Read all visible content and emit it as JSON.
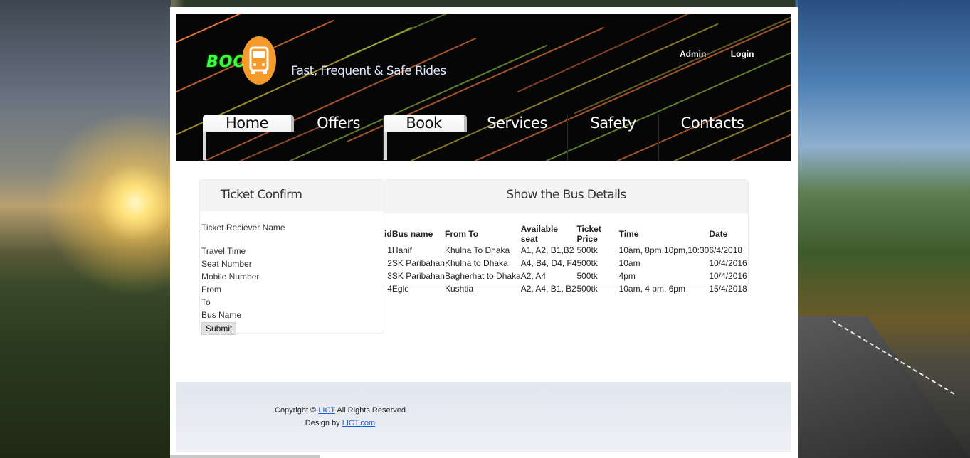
{
  "header": {
    "logo_text": "BOOK",
    "tagline": "Fast, Frequent & Safe Rides",
    "links": [
      {
        "label": "Admin"
      },
      {
        "label": "Login"
      }
    ]
  },
  "nav": {
    "items": [
      {
        "label": "Home",
        "active": true
      },
      {
        "label": "Offers",
        "active": false
      },
      {
        "label": "Book",
        "active": true
      },
      {
        "label": "Services",
        "active": false
      },
      {
        "label": "Safety",
        "active": false
      },
      {
        "label": "Contacts",
        "active": false
      }
    ]
  },
  "ticket_panel": {
    "title": "Ticket Confirm",
    "fields": [
      "Ticket Reciever Name",
      "Travel Time",
      "Seat Number",
      "Mobile Number",
      "From",
      "To",
      "Bus Name"
    ],
    "submit_label": "Submit"
  },
  "bus_panel": {
    "title": "Show the Bus Details",
    "columns": [
      "id",
      "Bus name",
      "From To",
      "Available seat",
      "Ticket Price",
      "Time",
      "Date"
    ],
    "rows": [
      [
        "1",
        "Hanif",
        "Khulna To Dhaka",
        "A1, A2, B1,B2",
        "500tk",
        "10am, 8pm,10pm,10:30",
        "6/4/2018"
      ],
      [
        "2",
        "SK Paribahan",
        "Khulna to Dhaka",
        "A4, B4, D4, F4",
        "500tk",
        "10am",
        "10/4/2016"
      ],
      [
        "3",
        "SK Paribahan",
        "Bagherhat to Dhaka",
        "A2, A4",
        "500tk",
        "4pm",
        "10/4/2016"
      ],
      [
        "4",
        "Egle",
        "Kushtia",
        "A2, A4, B1, B2",
        "500tk",
        "10am, 4 pm, 6pm",
        "15/4/2018"
      ]
    ]
  },
  "footer": {
    "copyright_prefix": "Copyright ©",
    "copyright_link": "LICT",
    "copyright_suffix": "All Rights Reserved",
    "design_prefix": "Design by",
    "design_link": "LICT.com"
  },
  "colors": {
    "header_bg": "#060606",
    "logo_orange": "#f39a2a",
    "logo_green": "#3cff3c",
    "link_blue": "#1a5fd0"
  }
}
